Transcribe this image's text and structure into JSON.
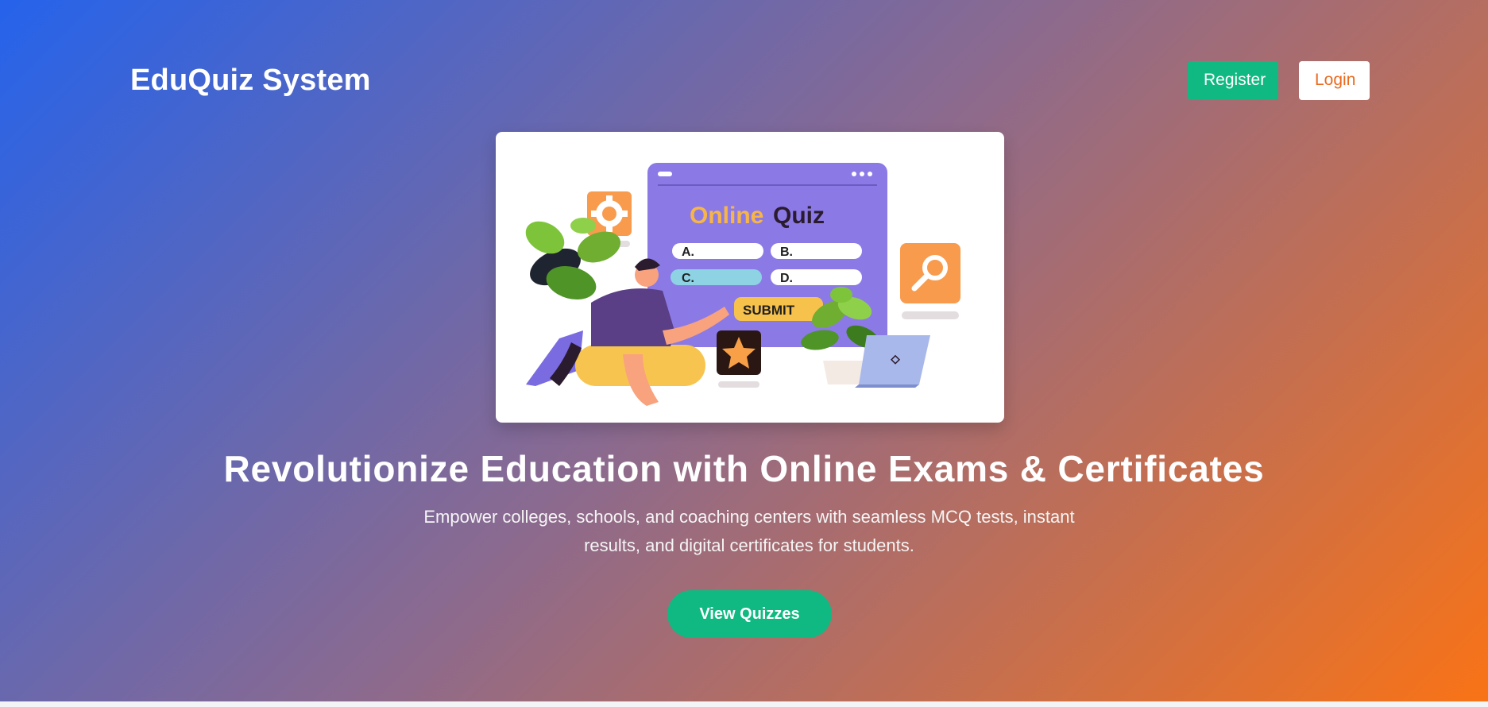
{
  "header": {
    "brand": "EduQuiz System",
    "register_label": "Register",
    "login_label": "Login"
  },
  "illustration": {
    "title_part1": "Online",
    "title_part2": "Quiz",
    "options": [
      "A.",
      "B.",
      "C.",
      "D."
    ],
    "submit_label": "SUBMIT"
  },
  "hero": {
    "headline": "Revolutionize Education with Online Exams & Certificates",
    "subtext_line1": "Empower colleges, schools, and coaching centers with seamless MCQ tests, instant",
    "subtext_line2": "results, and digital certificates for students.",
    "cta_label": "View Quizzes"
  },
  "colors": {
    "gradient_start": "#2563eb",
    "gradient_end": "#f97316",
    "green": "#10b981",
    "login_text": "#ea6a1d"
  }
}
